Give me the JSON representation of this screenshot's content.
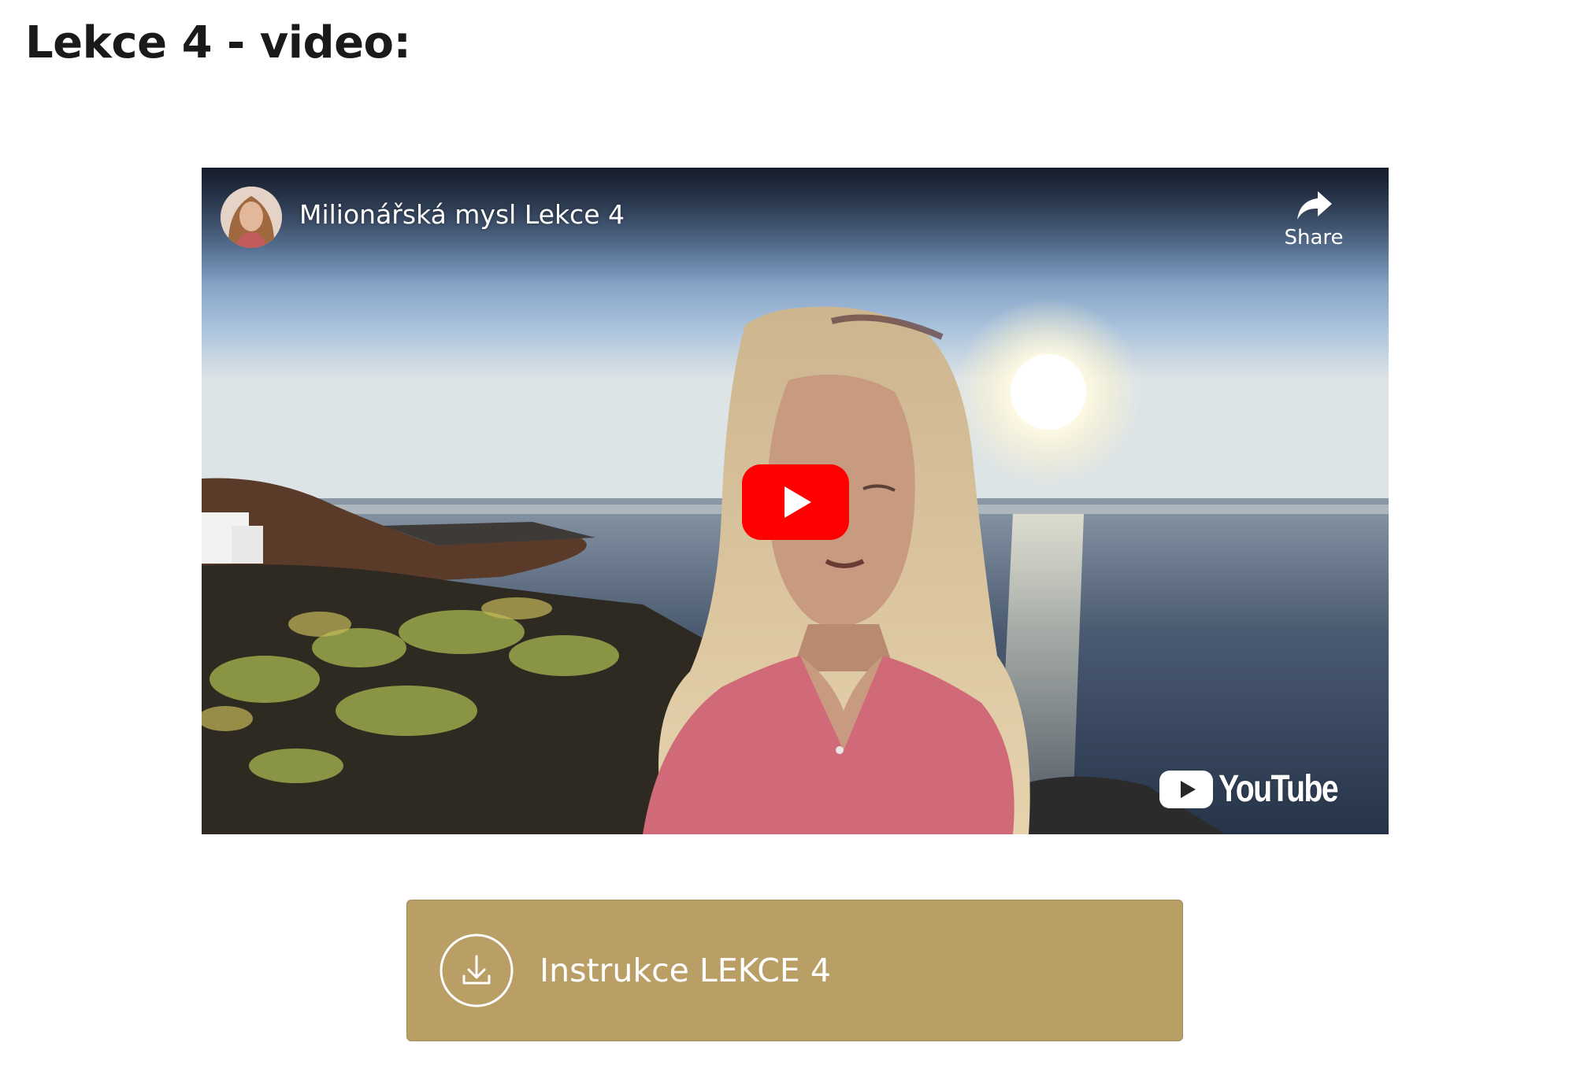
{
  "page": {
    "title": "Lekce 4 - video:"
  },
  "video": {
    "title": "Milionářská mysl Lekce 4",
    "share_label": "Share",
    "logo_text": "YouTube",
    "play_icon": "play-icon",
    "share_icon": "share-arrow-icon",
    "logo_icon": "youtube-icon",
    "play_color": "#ff0000"
  },
  "download": {
    "label": "Instrukce LEKCE 4",
    "icon": "download-icon",
    "background": "#b99e66"
  }
}
